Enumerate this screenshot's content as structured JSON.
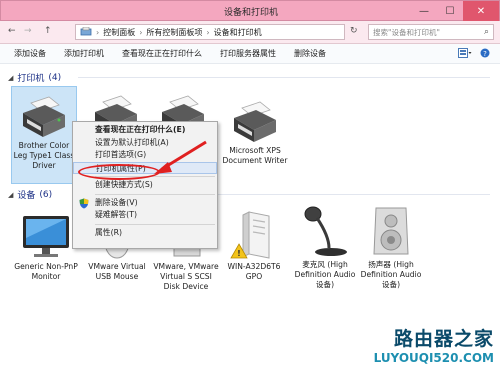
{
  "window": {
    "title": "设备和打印机",
    "minimize": "—",
    "maximize": "☐",
    "close": "✕"
  },
  "address": {
    "back": "←",
    "forward": "→",
    "up": "↑",
    "crumbs": [
      "控制面板",
      "所有控制面板项",
      "设备和打印机"
    ],
    "separator": "›",
    "refresh": "↻",
    "search_placeholder": "搜索\"设备和打印机\""
  },
  "toolbar": {
    "buttons": [
      "添加设备",
      "添加打印机",
      "查看现在正在打印什么",
      "打印服务器属性",
      "删除设备"
    ]
  },
  "groups": {
    "printers": {
      "label": "打印机",
      "count": "(4)"
    },
    "devices": {
      "label": "设备",
      "count": "(6)"
    }
  },
  "printers": [
    {
      "label": "Brother Color Leg Type1 Class Driver",
      "selected": true
    },
    {
      "label": "",
      "selected": false
    },
    {
      "label": "",
      "selected": false
    },
    {
      "label": "Microsoft XPS Document Writer",
      "selected": false
    }
  ],
  "devices": [
    {
      "label": "Generic Non-PnP Monitor",
      "icon": "monitor-icon"
    },
    {
      "label": "VMware Virtual USB Mouse",
      "icon": "mouse-icon"
    },
    {
      "label": "VMware, VMware Virtual S SCSI Disk Device",
      "icon": "disk-icon"
    },
    {
      "label": "WIN-A32D6T6 GPO",
      "icon": "computer-tower-icon"
    },
    {
      "label": "麦克风 (High Definition Audio 设备)",
      "icon": "microphone-icon"
    },
    {
      "label": "扬声器 (High Definition Audio 设备)",
      "icon": "speaker-icon"
    }
  ],
  "context_menu": {
    "items": [
      {
        "label": "查看现在正在打印什么(E)",
        "bold": true
      },
      {
        "label": "设置为默认打印机(A)"
      },
      {
        "label": "打印首选项(G)"
      },
      {
        "label": "打印机属性(P)",
        "highlighted": true
      },
      {
        "label": "创建快捷方式(S)"
      },
      {
        "label": "删除设备(V)",
        "shield": true
      },
      {
        "label": "疑难解答(T)"
      },
      {
        "label": "属性(R)"
      }
    ]
  },
  "watermark": {
    "line1": "路由器之家",
    "line2": "LUYOUQI520.COM"
  },
  "colors": {
    "titlebar": "#f4a7bf",
    "selection": "#cce4f7",
    "annotation": "#e02020"
  }
}
